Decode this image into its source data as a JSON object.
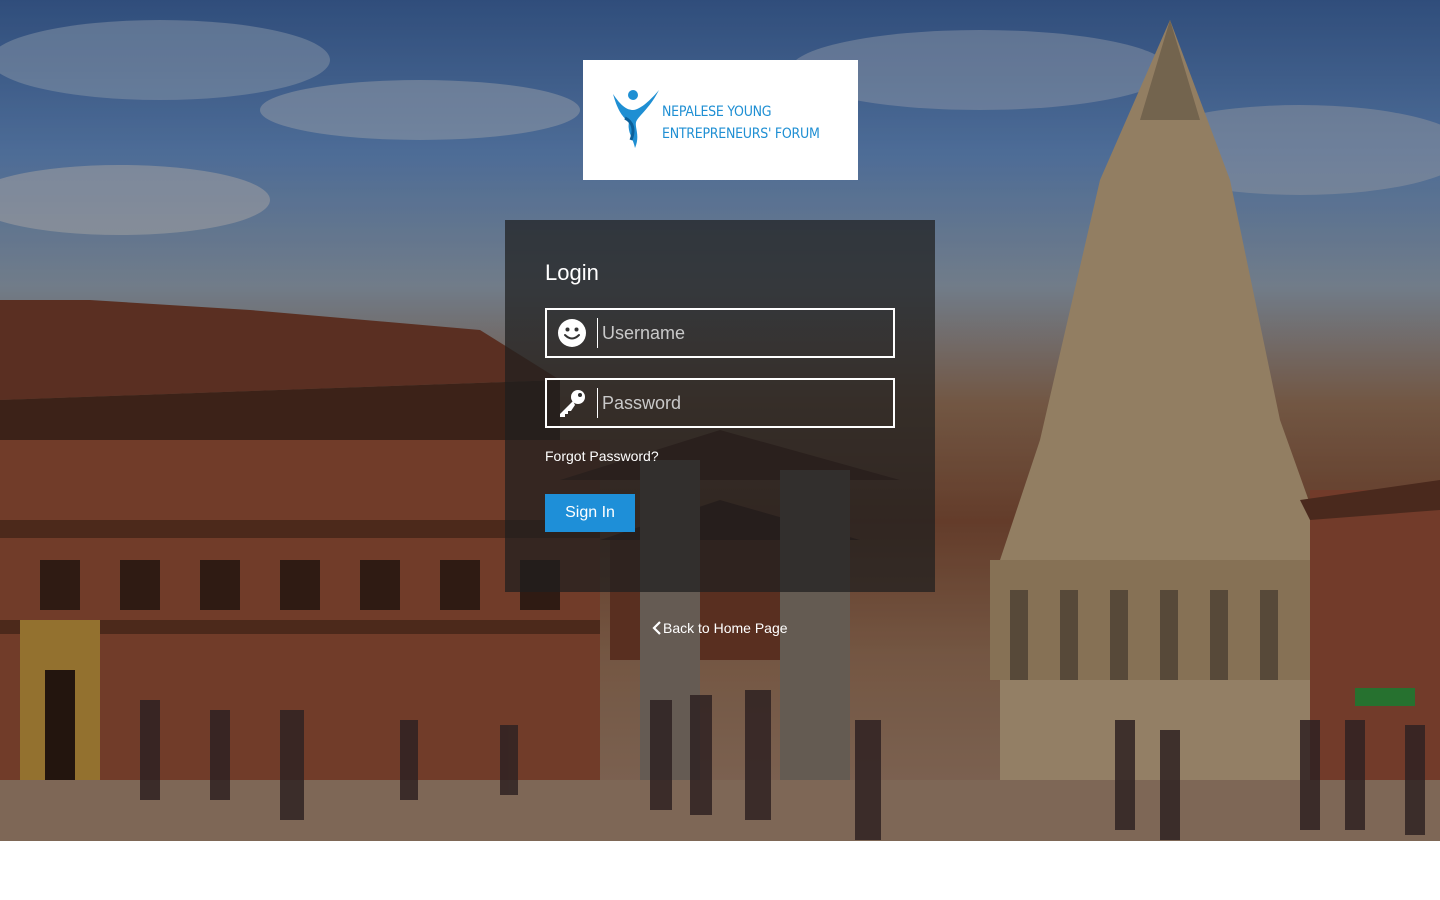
{
  "logo": {
    "line1": "NEPALESE YOUNG",
    "line2": "ENTREPRENEURS' FORUM",
    "brand_color": "#1f8fd3",
    "icon": "nyef-figure-logo-icon"
  },
  "login": {
    "title": "Login",
    "username": {
      "placeholder": "Username",
      "value": "",
      "icon": "smiley-face-icon"
    },
    "password": {
      "placeholder": "Password",
      "value": "",
      "icon": "key-icon"
    },
    "forgot_label": "Forgot Password?",
    "signin_label": "Sign In",
    "button_color": "#1e8fd8"
  },
  "footer": {
    "back_label": "Back to Home Page",
    "back_icon": "chevron-left-icon"
  },
  "background": {
    "description_icon": "temple-square-photo"
  }
}
